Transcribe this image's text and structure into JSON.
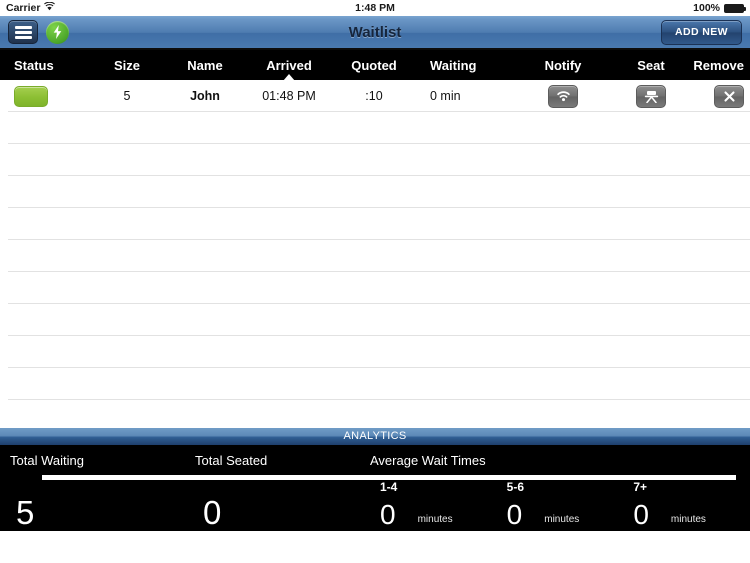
{
  "status_bar": {
    "carrier": "Carrier",
    "wifi_icon": "wifi-icon",
    "time": "1:48 PM",
    "battery_percent": "100%",
    "battery_icon": "battery-full-icon"
  },
  "navbar": {
    "menu_icon": "hamburger-menu-icon",
    "bolt_icon": "lightning-bolt-icon",
    "title": "Waitlist",
    "add_new_label": "ADD NEW"
  },
  "table": {
    "columns": [
      {
        "key": "status",
        "label": "Status"
      },
      {
        "key": "size",
        "label": "Size"
      },
      {
        "key": "name",
        "label": "Name"
      },
      {
        "key": "arrived",
        "label": "Arrived"
      },
      {
        "key": "quoted",
        "label": "Quoted"
      },
      {
        "key": "waiting",
        "label": "Waiting"
      },
      {
        "key": "notify",
        "label": "Notify"
      },
      {
        "key": "seat",
        "label": "Seat"
      },
      {
        "key": "remove",
        "label": "Remove"
      }
    ],
    "sorted_by": "Arrived",
    "sort_direction": "ascending",
    "rows": [
      {
        "status": "waiting",
        "status_color": "#8cbf33",
        "size": "5",
        "name": "John",
        "arrived": "01:48 PM",
        "quoted": ":10",
        "waiting": "0 min",
        "notify_icon": "wifi-notify-icon",
        "seat_icon": "seat-table-icon",
        "remove_icon": "close-x-icon"
      }
    ],
    "empty_row_count": 10
  },
  "analytics": {
    "title": "ANALYTICS",
    "total_waiting_label": "Total Waiting",
    "total_waiting_value": "5",
    "total_seated_label": "Total Seated",
    "total_seated_value": "0",
    "average_wait_label": "Average Wait Times",
    "wait_groups": [
      {
        "label": "1-4",
        "value": "0",
        "unit": "minutes"
      },
      {
        "label": "5-6",
        "value": "0",
        "unit": "minutes"
      },
      {
        "label": "7+",
        "value": "0",
        "unit": "minutes"
      }
    ]
  },
  "colors": {
    "navbar_blue": "#4e7cb0",
    "accent_green": "#8cbf33",
    "header_black": "#000000",
    "analytics_blue": "#2f5e93"
  }
}
